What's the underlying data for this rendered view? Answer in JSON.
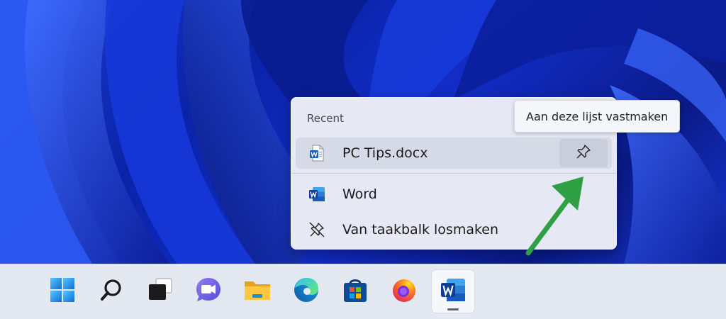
{
  "jumplist": {
    "recent_heading": "Recent",
    "recent_items": [
      {
        "label": "PC Tips.docx",
        "icon": "word-document-icon"
      }
    ],
    "tasks": [
      {
        "label": "Word",
        "icon": "word-app-icon"
      },
      {
        "label": "Van taakbalk losmaken",
        "icon": "unpin-icon"
      }
    ],
    "pin_button_icon": "pin-icon"
  },
  "tooltip": {
    "text": "Aan deze lijst vastmaken"
  },
  "annotation": {
    "color": "#2ea043"
  },
  "taskbar": {
    "apps": [
      {
        "icon": "windows-start-icon"
      },
      {
        "icon": "search-icon"
      },
      {
        "icon": "task-view-icon"
      },
      {
        "icon": "teams-chat-icon"
      },
      {
        "icon": "file-explorer-icon"
      },
      {
        "icon": "edge-icon"
      },
      {
        "icon": "microsoft-store-icon"
      },
      {
        "icon": "firefox-icon"
      },
      {
        "icon": "word-app-icon",
        "active": true
      }
    ]
  },
  "colors": {
    "accent": "#185abd",
    "desktop": "#1230c0"
  }
}
